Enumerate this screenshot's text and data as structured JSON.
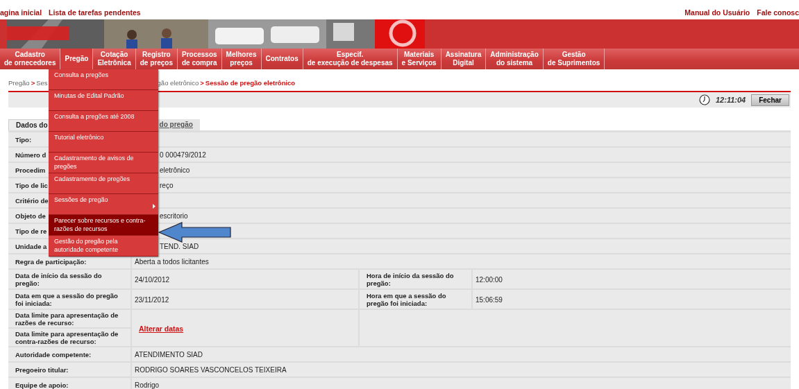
{
  "top_links": {
    "left": [
      "agina inicial",
      "Lista de tarefas pendentes"
    ],
    "right": [
      "Manual do Usuário",
      "Fale conosc"
    ]
  },
  "nav": [
    {
      "label": "Cadastro de ornecedores",
      "selected": false
    },
    {
      "label": "Pregão",
      "selected": true
    },
    {
      "label": "Cotação Eletrônica",
      "selected": false
    },
    {
      "label": "Registro de preços",
      "selected": false
    },
    {
      "label": "Processos de compra",
      "selected": false
    },
    {
      "label": "Melhores preços",
      "selected": false
    },
    {
      "label": "Contratos",
      "selected": false
    },
    {
      "label": "Especif. de execução de despesas",
      "selected": false
    },
    {
      "label": "Materiais e Serviços",
      "selected": false
    },
    {
      "label": "Assinatura Digital",
      "selected": false
    },
    {
      "label": "Administração do sistema",
      "selected": false
    },
    {
      "label": "Gestão de Suprimentos",
      "selected": false
    }
  ],
  "menu": [
    {
      "label": "Consulta a pregões",
      "selected": false,
      "submenu": false
    },
    {
      "label": "Minutas de Edital Padrão",
      "selected": false,
      "submenu": false
    },
    {
      "label": "Consulta a pregões até 2008",
      "selected": false,
      "submenu": false
    },
    {
      "label": "Tutorial eletrônico",
      "selected": false,
      "submenu": false
    },
    {
      "label": "Cadastramento de avisos de pregões",
      "selected": false,
      "submenu": false
    },
    {
      "label": "Cadastramento de pregões",
      "selected": false,
      "submenu": false
    },
    {
      "label": "Sessões de pregão",
      "selected": false,
      "submenu": true
    },
    {
      "label": "Parecer sobre recursos e contra-razões de recursos",
      "selected": true,
      "submenu": false
    },
    {
      "label": "Gestão do pregão pela autoridade competente",
      "selected": false,
      "submenu": false
    }
  ],
  "breadcrumb": {
    "left": [
      {
        "text": "Pregão",
        "current": false
      },
      {
        "text": "Ses",
        "current": false
      }
    ],
    "right": [
      {
        "text": "gão eletrônico",
        "current": false
      },
      {
        "text": "Sessão de pregão eletrônico",
        "current": true
      }
    ],
    "separator": ">"
  },
  "toolbar": {
    "time": "12:11:04",
    "close_button": "Fechar"
  },
  "tabs": [
    {
      "label": "Dados do",
      "selected": true
    },
    {
      "label": "do pregão",
      "selected": false
    }
  ],
  "rows": [
    {
      "kind": "pair",
      "label": "Tipo:"
    },
    {
      "kind": "pair",
      "label": "Número d",
      "value": "0 000479/2012",
      "value_cut": true
    },
    {
      "kind": "pair",
      "label": "Procedim",
      "value": "eletrônico",
      "value_cut": true
    },
    {
      "kind": "pair",
      "label": "Tipo de lic",
      "value": "reço",
      "value_cut": true
    },
    {
      "kind": "pair",
      "label": "Critério de"
    },
    {
      "kind": "pair",
      "label": "Objeto de",
      "value": "escritorio",
      "value_cut": true
    },
    {
      "kind": "pair",
      "label": "Tipo de re"
    },
    {
      "kind": "pair",
      "label": "Unidade a",
      "value": "TEND. SIAD",
      "value_cut": true
    },
    {
      "kind": "pair",
      "label": "Regra de participação:",
      "value": "Aberta a todos licitantes"
    },
    {
      "kind": "quad",
      "label": "Data de início da sessão do pregão:",
      "value": "24/10/2012",
      "label2": "Hora de início da sessão do pregão:",
      "value2": "12:00:00"
    },
    {
      "kind": "quad",
      "label": "Data em que a sessão do pregão foi iniciada:",
      "value": "23/11/2012",
      "label2": "Hora em que a sessão do pregão foi iniciada:",
      "value2": "15:06:59"
    },
    {
      "kind": "dates",
      "labels": [
        "Data limite para apresentação de razões de recurso:",
        "Data limite para apresentação de contra-razões de recurso:"
      ],
      "link": "Alterar datas"
    },
    {
      "kind": "pair",
      "label": "Autoridade competente:",
      "value": "ATENDIMENTO SIAD"
    },
    {
      "kind": "pair",
      "label": "Pregoeiro titular:",
      "value": "RODRIGO SOARES VASCONCELOS TEIXEIRA"
    },
    {
      "kind": "pair",
      "label": "Equipe de apoio:",
      "value": "Rodrigo"
    }
  ]
}
